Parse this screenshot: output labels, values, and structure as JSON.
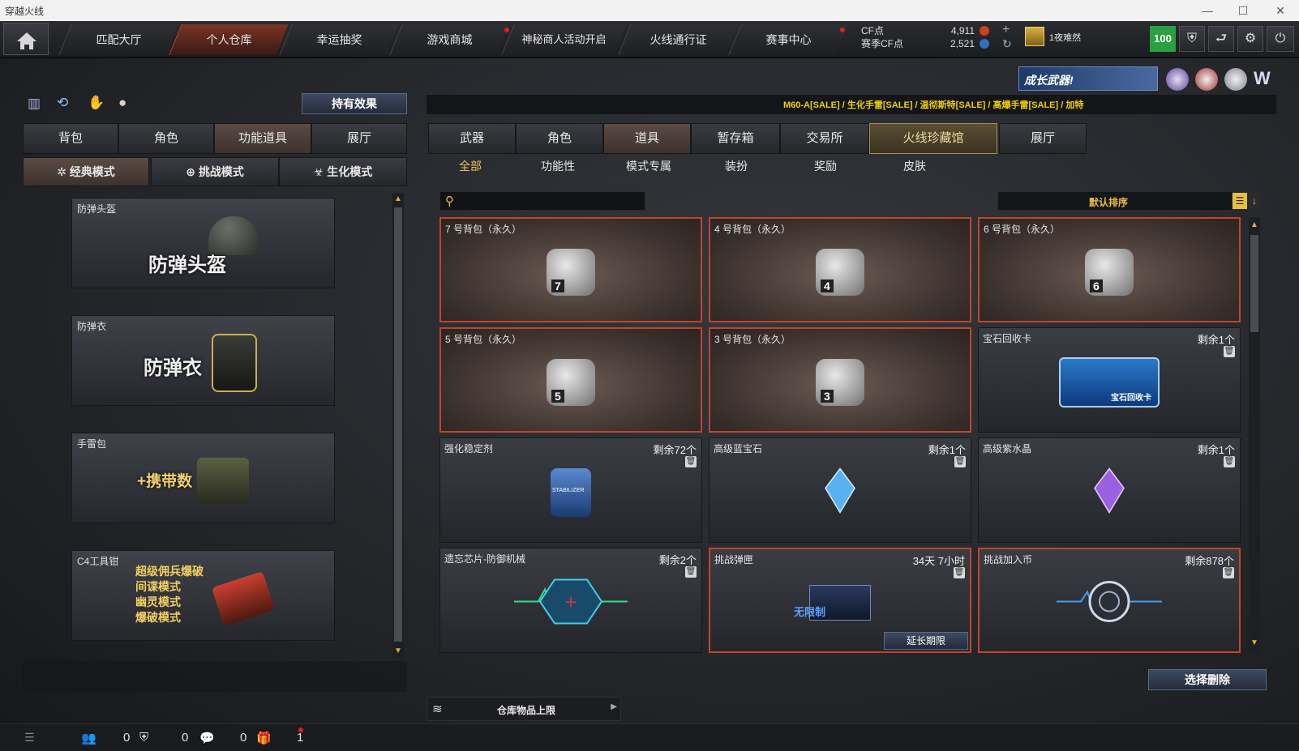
{
  "window": {
    "title": "穿越火线",
    "minimize": "—",
    "maximize": "☐",
    "close": "✕"
  },
  "topnav": {
    "home_icon": "home-icon",
    "tabs": [
      {
        "label": "匹配大厅"
      },
      {
        "label": "个人仓库",
        "active": true
      },
      {
        "label": "幸运抽奖"
      },
      {
        "label": "游戏商城"
      },
      {
        "label": "神秘商人活动开启"
      },
      {
        "label": "火线通行证"
      },
      {
        "label": "赛事中心"
      }
    ],
    "cf_label": "CF点",
    "cf_value": "4,911",
    "season_label": "赛季CF点",
    "season_value": "2,521",
    "add": "+",
    "refresh": "↻",
    "difficulty": "1夜难然",
    "level": "100",
    "icons": [
      "shield-icon",
      "exit-icon",
      "gear-icon",
      "power-icon"
    ]
  },
  "left": {
    "icons": [
      "ranking-icon",
      "recycle-icon",
      "hand-icon",
      "grenade-icon"
    ],
    "effects_button": "持有效果",
    "tabs": [
      "背包",
      "角色",
      "功能道具",
      "展厅"
    ],
    "active_tab": 2,
    "modes": [
      "经典模式",
      "挑战模式",
      "生化模式"
    ],
    "cards": [
      {
        "name": "防弹头盔",
        "big": "防弹头盔"
      },
      {
        "name": "防弹衣",
        "big": "防弹衣"
      },
      {
        "name": "手雷包",
        "big": "+携带数"
      },
      {
        "name": "C4工具钳",
        "lines": [
          "超级佣兵爆破",
          "间谍模式",
          "幽灵模式",
          "爆破模式"
        ]
      }
    ]
  },
  "banner": {
    "text": "成长武器!",
    "ticker": "M60-A[SALE] / 生化手雷[SALE] / 温彻斯特[SALE] / 高爆手雷[SALE] / 加特"
  },
  "right": {
    "tabs": [
      "武器",
      "角色",
      "道具",
      "暂存箱",
      "交易所",
      "火线珍藏馆",
      "展厅"
    ],
    "active_tab": 2,
    "subtabs": [
      "全部",
      "功能性",
      "模式专属",
      "装扮",
      "奖励",
      "皮肤"
    ],
    "search_placeholder": "",
    "sort_label": "默认排序",
    "items": [
      {
        "name": "7 号背包（永久）",
        "count": "",
        "bag": "7"
      },
      {
        "name": "4 号背包（永久）",
        "count": "",
        "bag": "4"
      },
      {
        "name": "6 号背包（永久）",
        "count": "",
        "bag": "6"
      },
      {
        "name": "5 号背包（永久）",
        "count": "",
        "bag": "5"
      },
      {
        "name": "3 号背包（永久）",
        "count": "",
        "bag": "3"
      },
      {
        "name": "宝石回收卡",
        "count": "剩余1个",
        "card_text": "宝石回收卡"
      },
      {
        "name": "强化稳定剂",
        "count": "剩余72个",
        "jar_text": "STABILIZER"
      },
      {
        "name": "高级蓝宝石",
        "count": "剩余1个"
      },
      {
        "name": "高级紫水晶",
        "count": "剩余1个"
      },
      {
        "name": "遗忘芯片-防御机械",
        "count": "剩余2个"
      },
      {
        "name": "挑战弹匣",
        "count": "34天 7小时",
        "extend": "延长期限",
        "ammo_text": "无限制"
      },
      {
        "name": "挑战加入币",
        "count": "剩余878个"
      }
    ],
    "delete_button": "选择删除",
    "capacity_label": "仓库物品上限"
  },
  "bottom": {
    "values": [
      "0",
      "0",
      "0",
      "1"
    ]
  },
  "colors": {
    "accent_red": "#c2442c",
    "gold": "#f0c060",
    "ticker": "#f0d000"
  }
}
